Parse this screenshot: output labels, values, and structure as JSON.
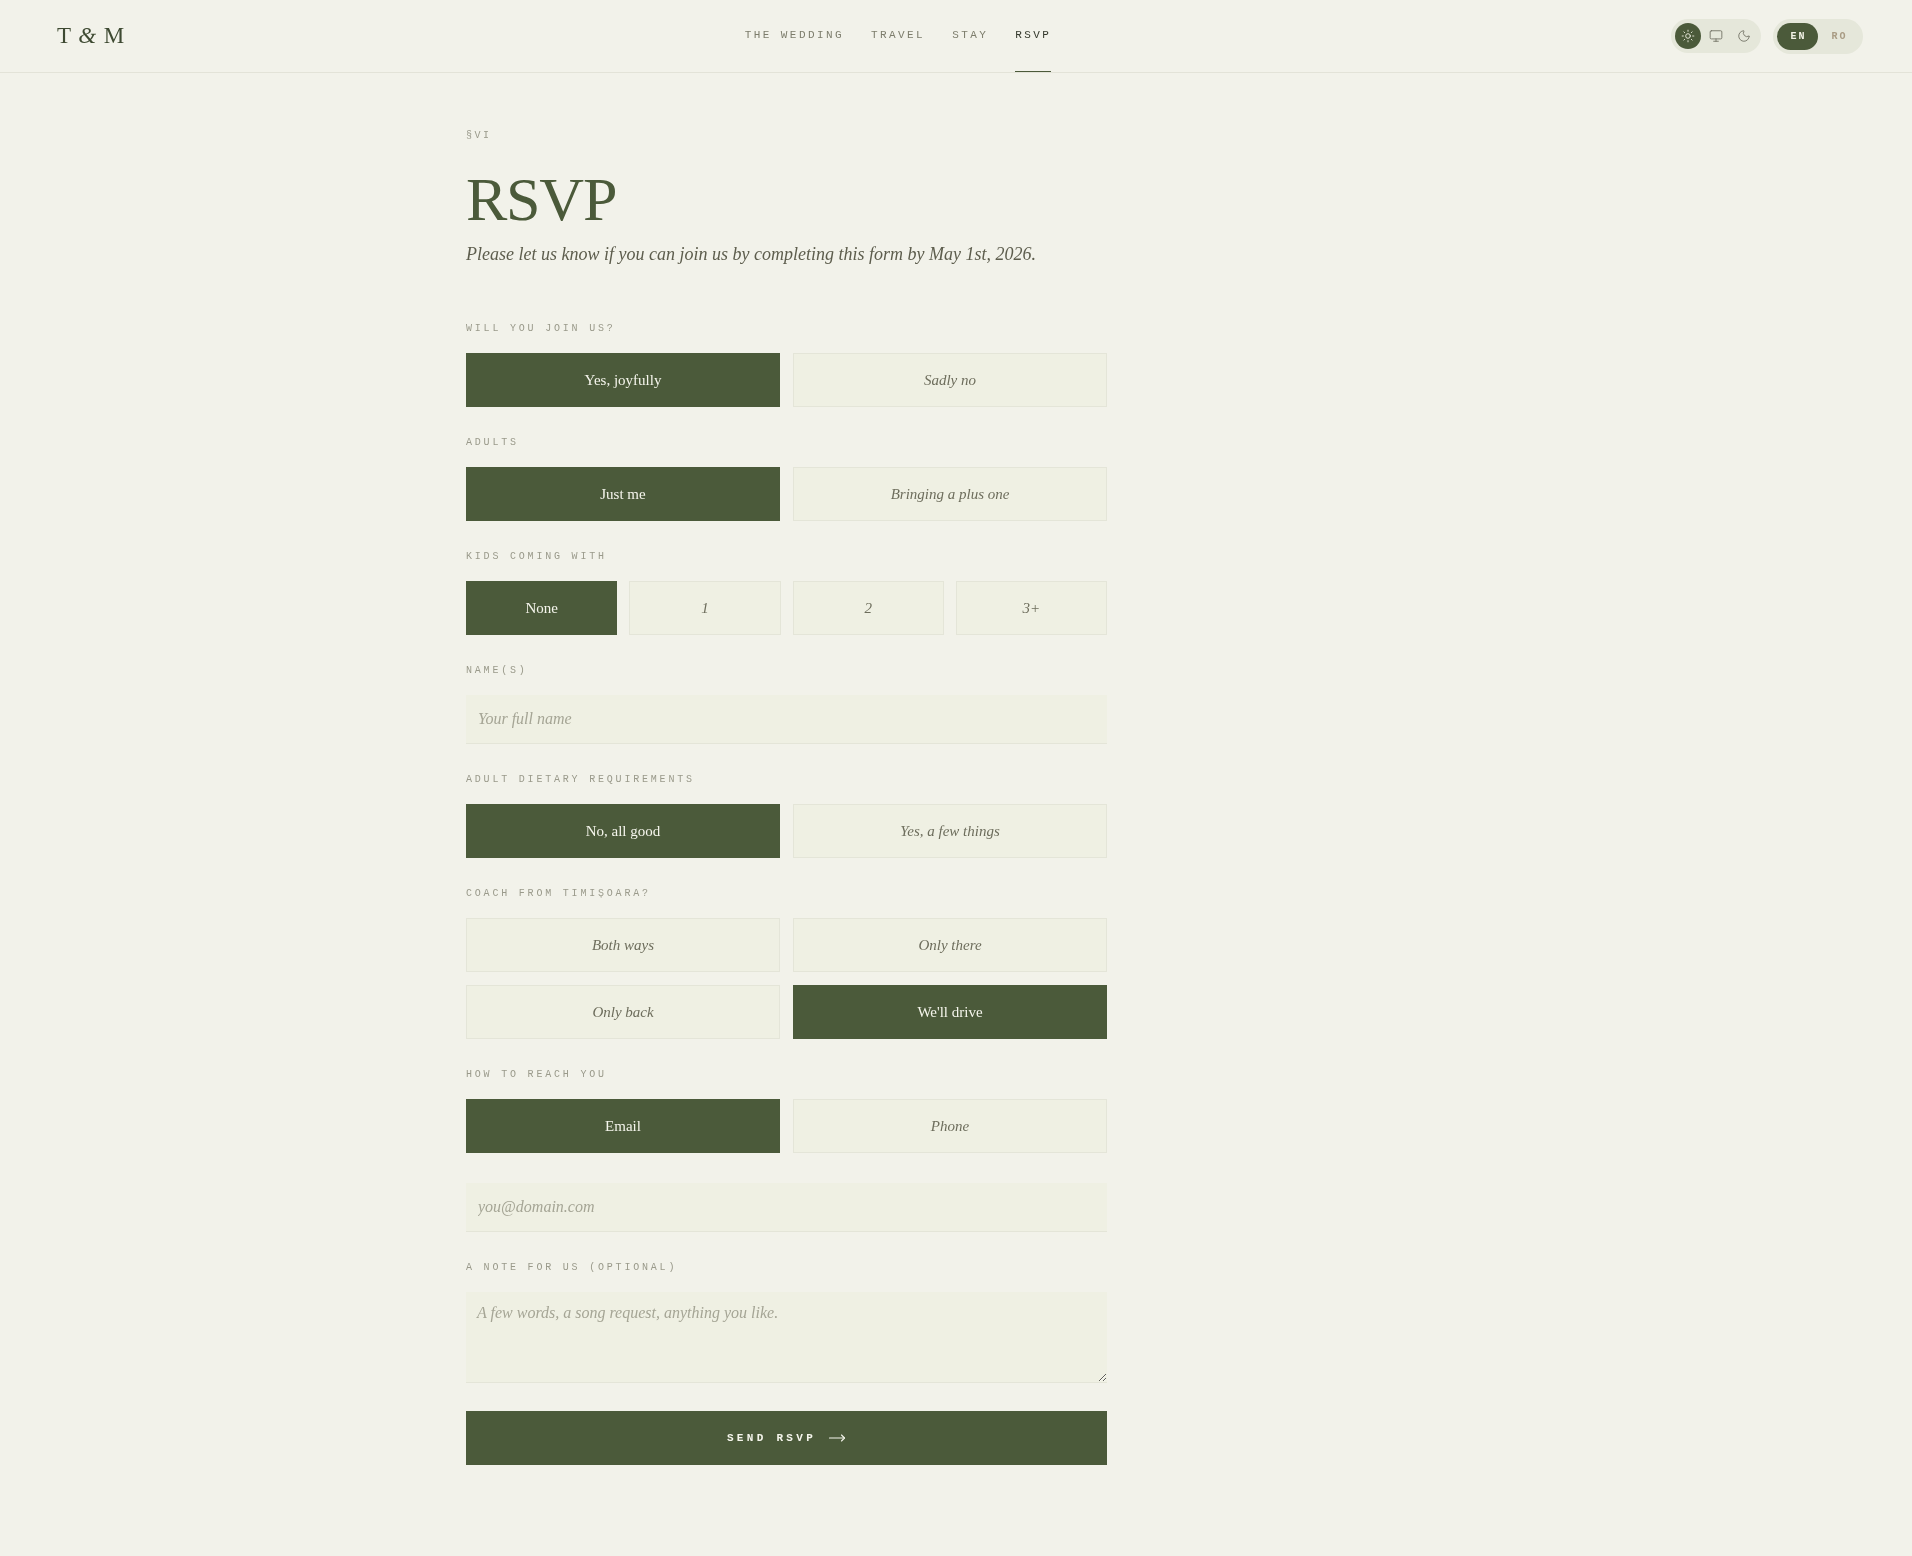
{
  "header": {
    "logo": "T *&* M",
    "nav": [
      {
        "label": "THE WEDDING",
        "selected": false
      },
      {
        "label": "TRAVEL",
        "selected": false
      },
      {
        "label": "STAY",
        "selected": false
      },
      {
        "label": "RSVP",
        "selected": true
      }
    ],
    "theme_options": [
      {
        "kind": "light",
        "selected": true
      },
      {
        "kind": "system",
        "selected": false
      },
      {
        "kind": "dark",
        "selected": false
      }
    ],
    "languages": [
      {
        "label": "EN",
        "selected": true
      },
      {
        "label": "RO",
        "selected": false
      }
    ]
  },
  "section": {
    "number": "§VI",
    "title": "RSVP",
    "intro": "Please let us know if you can join us by completing this form by May 1st, 2026."
  },
  "form": {
    "fields": [
      {
        "kind": "choice",
        "label": "WILL YOU JOIN US?",
        "options": [
          {
            "label": "Yes, joyfully",
            "selected": true
          },
          {
            "label": "Sadly no",
            "selected": false
          }
        ]
      },
      {
        "kind": "choice",
        "label": "ADULTS",
        "options": [
          {
            "label": "Just me",
            "selected": true
          },
          {
            "label": "Bringing a plus one",
            "selected": false
          }
        ]
      },
      {
        "kind": "count",
        "label": "KIDS COMING WITH",
        "options": [
          {
            "label": "None",
            "selected": true
          },
          {
            "label": "1",
            "selected": false
          },
          {
            "label": "2",
            "selected": false
          },
          {
            "label": "3+",
            "selected": false
          }
        ]
      },
      {
        "kind": "text",
        "label": "NAME(S)",
        "placeholder": "Your full name"
      },
      {
        "kind": "choice",
        "label": "ADULT DIETARY REQUIREMENTS",
        "options": [
          {
            "label": "No, all good",
            "selected": true
          },
          {
            "label": "Yes, a few things",
            "selected": false
          }
        ]
      },
      {
        "kind": "choice",
        "label": "COACH FROM TIMIȘOARA?",
        "options": [
          {
            "label": "Both ways",
            "selected": false
          },
          {
            "label": "Only there",
            "selected": false
          },
          {
            "label": "Only back",
            "selected": false
          },
          {
            "label": "We'll drive",
            "selected": true
          }
        ]
      },
      {
        "kind": "choice",
        "label": "HOW TO REACH YOU",
        "options": [
          {
            "label": "Email",
            "selected": true
          },
          {
            "label": "Phone",
            "selected": false
          }
        ]
      },
      {
        "kind": "text",
        "placeholder": "you@domain.com"
      },
      {
        "kind": "textarea",
        "label": "A NOTE FOR US (OPTIONAL)",
        "placeholder": "A few words, a song request, anything you like."
      }
    ],
    "submit": "SEND RSVP"
  }
}
